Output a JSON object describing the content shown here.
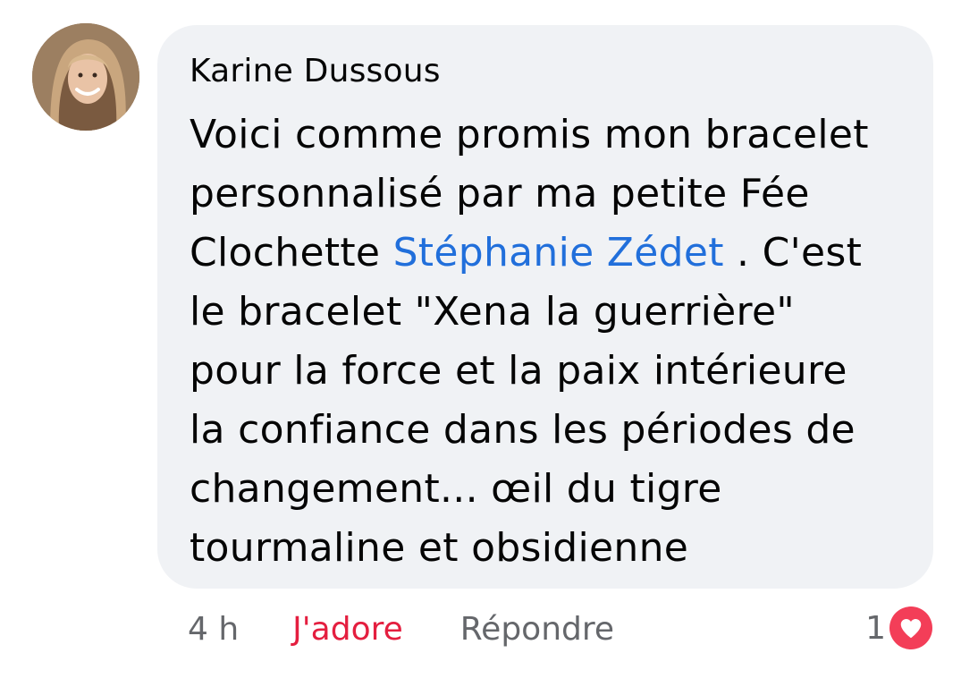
{
  "comment": {
    "author": "Karine Dussous",
    "lines": [
      {
        "text": "Voici comme promis mon bracelet"
      },
      {
        "text": "personnalisé par ma petite Fée"
      },
      {
        "before": "Clochette ",
        "mention": "Stéphanie Zédet",
        "after": " . C'est"
      },
      {
        "text": "le bracelet \"Xena la guerrière\""
      },
      {
        "text": "pour la force et la paix intérieure"
      },
      {
        "text": "la confiance dans les périodes de"
      },
      {
        "text": "changement... œil du tigre"
      },
      {
        "text": "tourmaline et obsidienne"
      }
    ]
  },
  "actions": {
    "timestamp": "4 h",
    "love_label": "J'adore",
    "reply_label": "Répondre"
  },
  "reactions": {
    "count": "1",
    "icon": "heart-icon",
    "color": "#f33e58"
  },
  "colors": {
    "bubble": "#f0f2f5",
    "mention": "#216fdb",
    "love": "#e41e3f",
    "muted": "#65676b"
  }
}
